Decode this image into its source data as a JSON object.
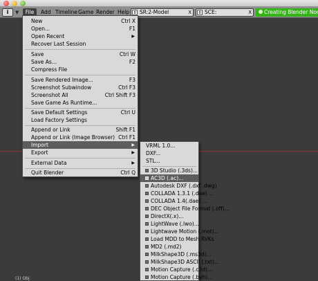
{
  "header": {
    "menus": {
      "file": "File",
      "add": "Add",
      "timeline": "Timeline",
      "game": "Game",
      "render": "Render",
      "help": "Help"
    },
    "screen_field": {
      "text": "SR:2-Model",
      "close": "X"
    },
    "scene_field": {
      "text": "SCE:",
      "close": "X"
    },
    "status": "Creating Blender Nodes."
  },
  "file_menu": {
    "items": [
      {
        "label": "New",
        "shortcut": "Ctrl X"
      },
      {
        "label": "Open...",
        "shortcut": "F1"
      },
      {
        "label": "Open Recent",
        "shortcut": ""
      },
      {
        "label": "Recover Last Session",
        "shortcut": ""
      },
      {
        "label": "Save",
        "shortcut": "Ctrl W"
      },
      {
        "label": "Save As...",
        "shortcut": "F2"
      },
      {
        "label": "Compress File",
        "shortcut": ""
      },
      {
        "label": "Save Rendered Image...",
        "shortcut": "F3"
      },
      {
        "label": "Screenshot Subwindow",
        "shortcut": "Ctrl F3"
      },
      {
        "label": "Screenshot All",
        "shortcut": "Ctrl Shift F3"
      },
      {
        "label": "Save Game As Runtime...",
        "shortcut": ""
      },
      {
        "label": "Save Default Settings",
        "shortcut": "Ctrl U"
      },
      {
        "label": "Load Factory Settings",
        "shortcut": ""
      },
      {
        "label": "Append or Link",
        "shortcut": "Shift F1"
      },
      {
        "label": "Append or Link (Image Browser)",
        "shortcut": "Ctrl F1"
      },
      {
        "label": "Import",
        "shortcut": ""
      },
      {
        "label": "Export",
        "shortcut": ""
      },
      {
        "label": "External Data",
        "shortcut": ""
      },
      {
        "label": "Quit Blender",
        "shortcut": "Ctrl Q"
      }
    ]
  },
  "import_menu": {
    "items": [
      {
        "label": "VRML 1.0..."
      },
      {
        "label": "DXF..."
      },
      {
        "label": "STL..."
      },
      {
        "label": "3D Studio (.3ds)..."
      },
      {
        "label": "AC3D (.ac)..."
      },
      {
        "label": "Autodesk DXF (.dxf .dwg)"
      },
      {
        "label": "COLLADA 1.3.1 (.dae) ..."
      },
      {
        "label": "COLLADA 1.4(.dae) ..."
      },
      {
        "label": "DEC Object File Format (.off)..."
      },
      {
        "label": "DirectX(.x)..."
      },
      {
        "label": "LightWave (.lwo)..."
      },
      {
        "label": "Lightwave Motion (.mot)..."
      },
      {
        "label": "Load MDD to Mesh RVKs"
      },
      {
        "label": "MD2 (.md2)"
      },
      {
        "label": "MilkShape3D (.ms3d)..."
      },
      {
        "label": "MilkShape3D ASCII (.txt)..."
      },
      {
        "label": "Motion Capture (.c3d)..."
      },
      {
        "label": "Motion Capture (.bvh)..."
      }
    ]
  },
  "viewport": {
    "text": "(1) Obj"
  },
  "colors": {
    "status_green": "#36b21b",
    "highlight": "#5d5d5d",
    "menu_bg": "#d9d9d9"
  }
}
